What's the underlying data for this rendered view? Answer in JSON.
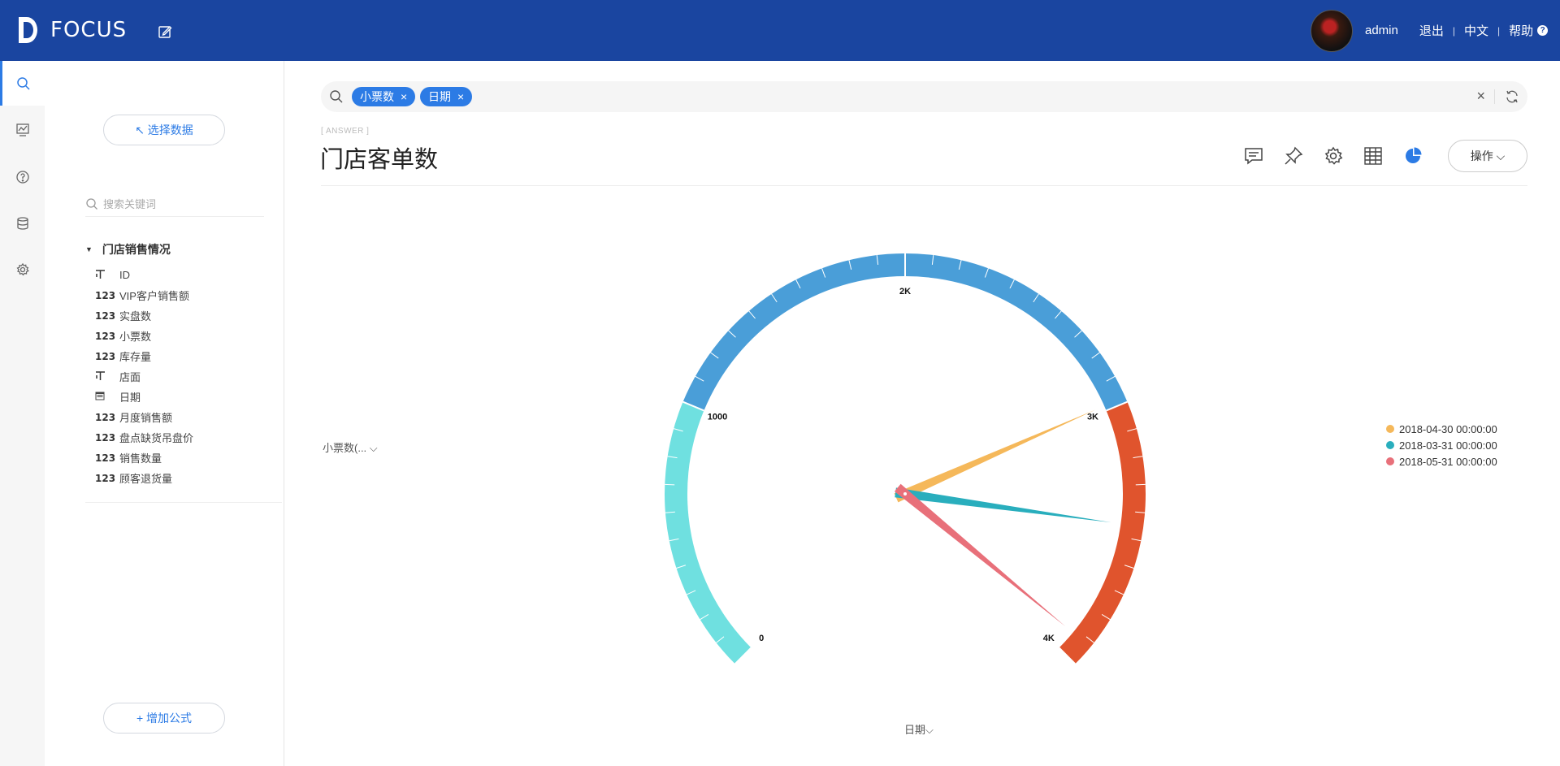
{
  "app": {
    "logo_text": "FOCUS",
    "user": "admin",
    "logout": "退出",
    "language": "中文",
    "help": "帮助",
    "help_mark": "?",
    "separator": "|"
  },
  "rail": {
    "items": [
      "search-icon",
      "dashboard-icon",
      "help-icon",
      "database-icon",
      "settings-icon"
    ]
  },
  "panel": {
    "select_data": "↖ 选择数据",
    "search_placeholder": "搜索关键词",
    "table_name": "门店销售情况",
    "fields": [
      {
        "type": "T",
        "name": "ID"
      },
      {
        "type": "123",
        "name": "VIP客户销售额"
      },
      {
        "type": "123",
        "name": "实盘数"
      },
      {
        "type": "123",
        "name": "小票数"
      },
      {
        "type": "123",
        "name": "库存量"
      },
      {
        "type": "T",
        "name": "店面"
      },
      {
        "type": "date",
        "name": "日期"
      },
      {
        "type": "123",
        "name": "月度销售额"
      },
      {
        "type": "123",
        "name": "盘点缺货吊盘价"
      },
      {
        "type": "123",
        "name": "销售数量"
      },
      {
        "type": "123",
        "name": "顾客退货量"
      }
    ],
    "add_formula": "+ 增加公式"
  },
  "search": {
    "chips": [
      "小票数",
      "日期"
    ],
    "chip_close": "×",
    "clear": "×"
  },
  "answer": {
    "tag": "[ ANSWER ]",
    "title": "门店客单数",
    "operate": "操作 ⌵"
  },
  "y_selector": "小票数(... ⌵",
  "x_selector": "日期⌵",
  "colors": {
    "topbar": "#1a45a0",
    "accent": "#2c7be5",
    "band_low": "#6fe0e0",
    "band_mid": "#4a9ed8",
    "band_high": "#e0542d"
  },
  "chart_data": {
    "type": "gauge",
    "min": 0,
    "max": 4000,
    "axis_labels": [
      "0",
      "1000",
      "2K",
      "3K",
      "4K"
    ],
    "bands": [
      {
        "from": 0,
        "to": 1000,
        "color": "#6fe0e0"
      },
      {
        "from": 1000,
        "to": 3000,
        "color": "#4a9ed8"
      },
      {
        "from": 3000,
        "to": 4000,
        "color": "#e0542d"
      }
    ],
    "series": [
      {
        "name": "2018-04-30 00:00:00",
        "value": 2980,
        "color": "#f5b85a"
      },
      {
        "name": "2018-03-31 00:00:00",
        "value": 3450,
        "color": "#29aebd"
      },
      {
        "name": "2018-05-31 00:00:00",
        "value": 3920,
        "color": "#e8707a"
      }
    ]
  }
}
